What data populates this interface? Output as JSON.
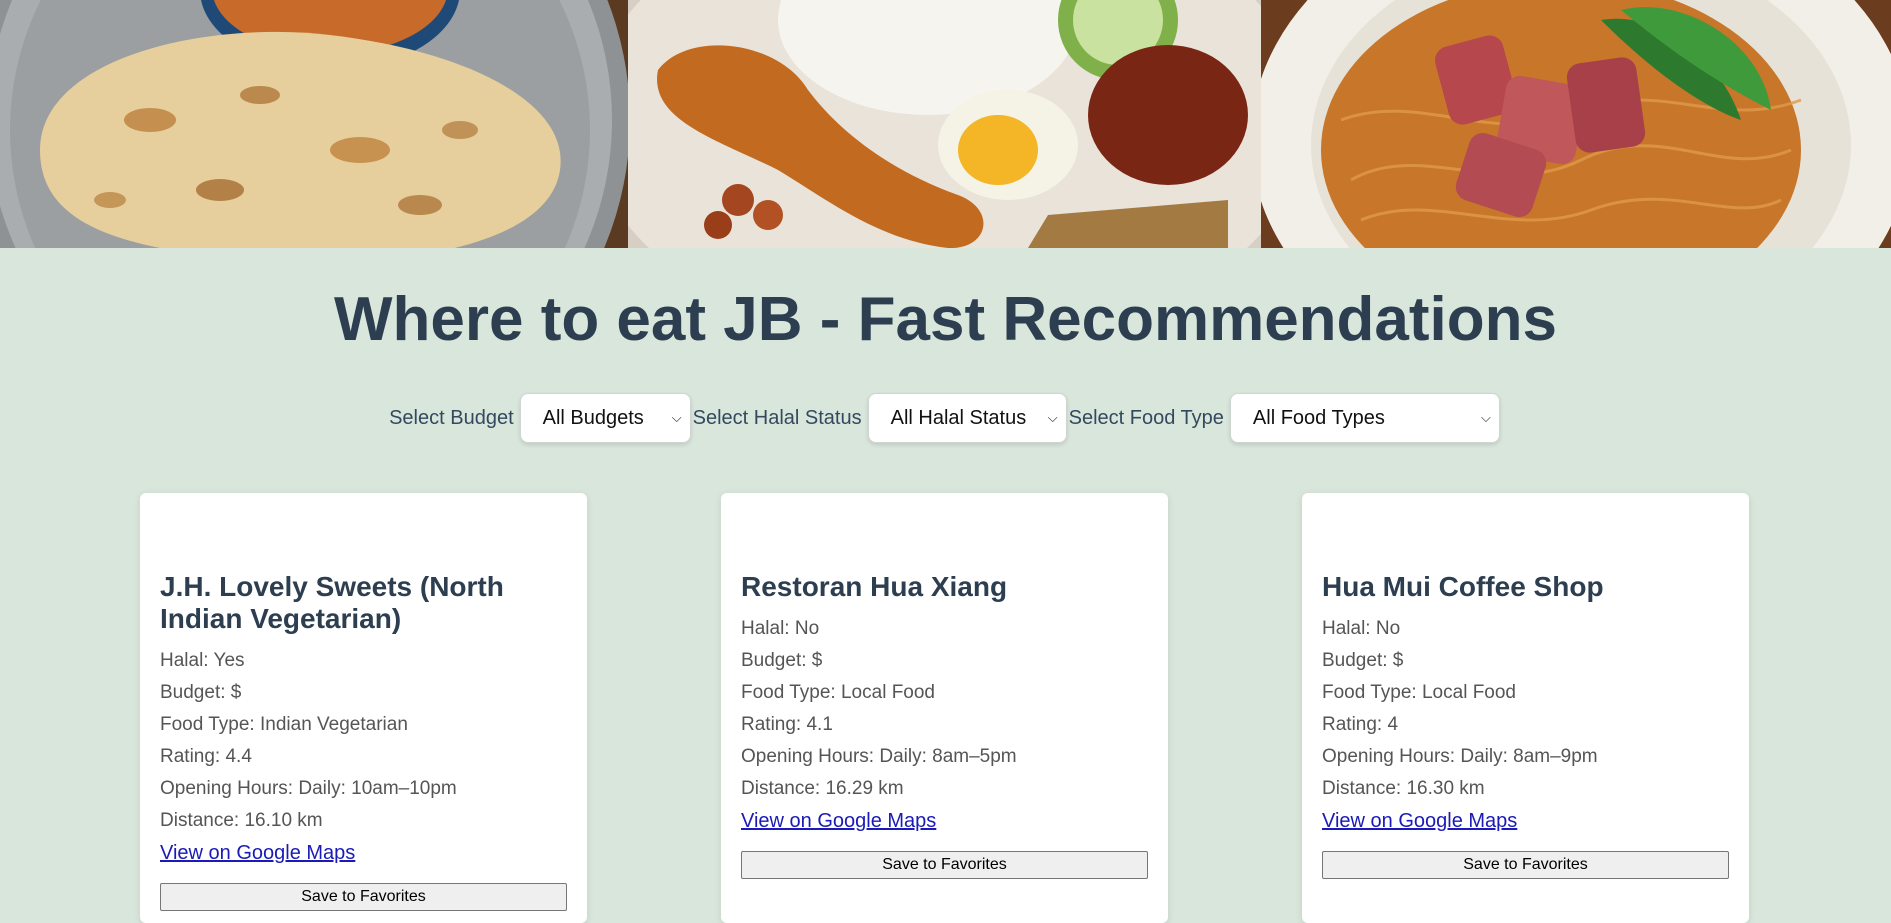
{
  "page": {
    "title": "Where to eat JB - Fast Recommendations"
  },
  "hero": {
    "images": [
      "roti-canai-image",
      "nasi-lemak-image",
      "wantan-mee-image"
    ]
  },
  "filters": {
    "budget": {
      "label": "Select Budget",
      "selected": "All Budgets"
    },
    "halal": {
      "label": "Select Halal Status",
      "selected": "All Halal Status"
    },
    "food_type": {
      "label": "Select Food Type",
      "selected": "All Food Types"
    }
  },
  "restaurants": [
    {
      "name": "J.H. Lovely Sweets (North Indian Vegetarian)",
      "halal": "Halal: Yes",
      "budget": "Budget: $",
      "food_type": "Food Type: Indian Vegetarian",
      "rating": "Rating: 4.4",
      "hours": "Opening Hours: Daily: 10am–10pm",
      "distance": "Distance: 16.10 km",
      "map_link": "View on Google Maps",
      "save_label": "Save to Favorites"
    },
    {
      "name": "Restoran Hua Xiang",
      "halal": "Halal: No",
      "budget": "Budget: $",
      "food_type": "Food Type: Local Food",
      "rating": "Rating: 4.1",
      "hours": "Opening Hours: Daily: 8am–5pm",
      "distance": "Distance: 16.29 km",
      "map_link": "View on Google Maps",
      "save_label": "Save to Favorites"
    },
    {
      "name": "Hua Mui Coffee Shop",
      "halal": "Halal: No",
      "budget": "Budget: $",
      "food_type": "Food Type: Local Food",
      "rating": "Rating: 4",
      "hours": "Opening Hours: Daily: 8am–9pm",
      "distance": "Distance: 16.30 km",
      "map_link": "View on Google Maps",
      "save_label": "Save to Favorites"
    }
  ],
  "colors": {
    "background": "#d9e6dc",
    "heading": "#2c3e50",
    "link": "#1a1ab8"
  }
}
